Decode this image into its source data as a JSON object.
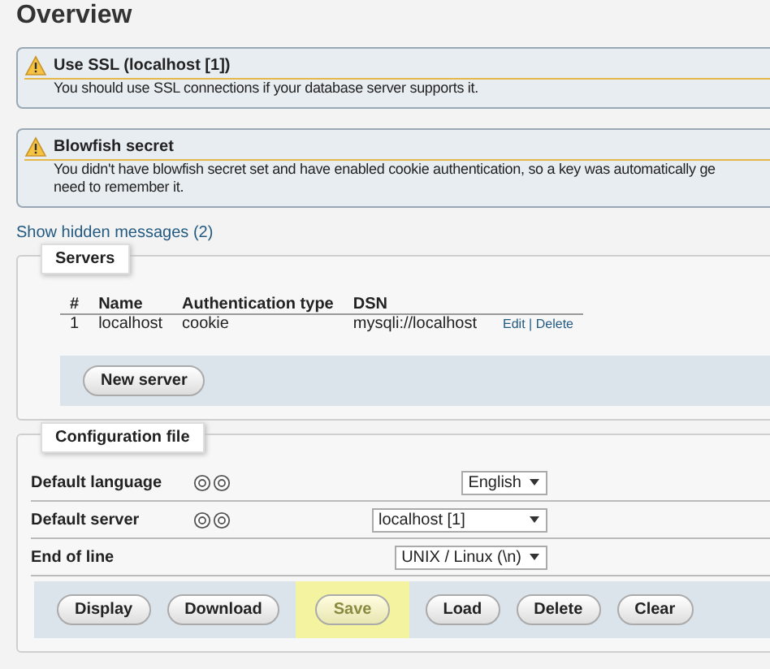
{
  "title": "Overview",
  "notices": [
    {
      "title": "Use SSL (localhost [1])",
      "lines": [
        "You should use SSL connections if your database server supports it."
      ]
    },
    {
      "title": "Blowfish secret",
      "lines": [
        "You didn't have blowfish secret set and have enabled cookie authentication, so a key was automatically ge",
        "need to remember it."
      ]
    }
  ],
  "hidden_link": "Show hidden messages (2)",
  "servers": {
    "legend": "Servers",
    "columns": [
      "#",
      "Name",
      "Authentication type",
      "DSN"
    ],
    "rows": [
      {
        "cells": [
          "1",
          "localhost",
          "cookie",
          "mysqli://localhost"
        ],
        "edit": "Edit",
        "separator": "|",
        "delete": "Delete"
      }
    ],
    "new_button": "New server"
  },
  "config": {
    "legend": "Configuration file",
    "settings": [
      {
        "label": "Default language",
        "help": true,
        "value": "English"
      },
      {
        "label": "Default server",
        "help": true,
        "value": "localhost [1]"
      },
      {
        "label": "End of line",
        "help": false,
        "value": "UNIX / Linux (\\n)"
      }
    ],
    "buttons": [
      {
        "label": "Display",
        "highlighted": false
      },
      {
        "label": "Download",
        "highlighted": false
      },
      {
        "label": "Save",
        "highlighted": true
      },
      {
        "label": "Load",
        "highlighted": false
      },
      {
        "label": "Delete",
        "highlighted": false
      },
      {
        "label": "Clear",
        "highlighted": false
      }
    ]
  }
}
